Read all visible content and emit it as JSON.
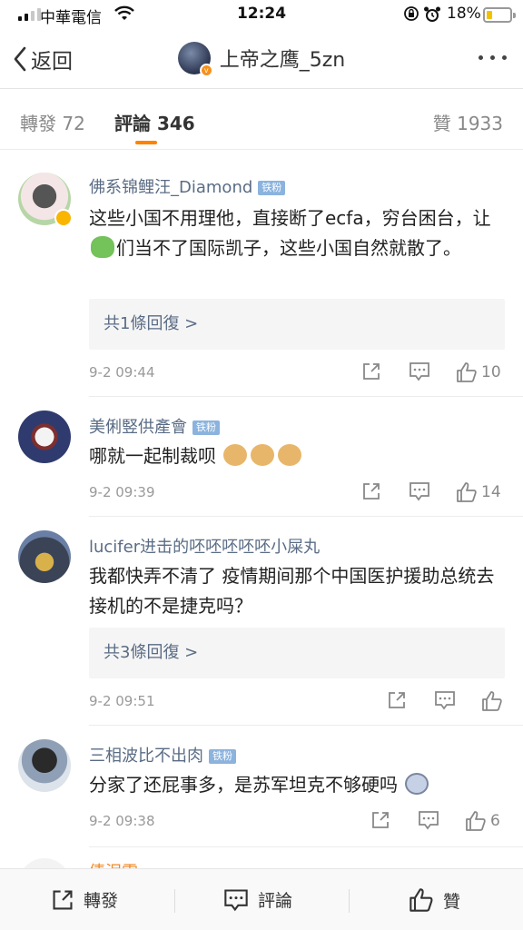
{
  "status": {
    "carrier": "中華電信",
    "time": "12:24",
    "battery": "18%"
  },
  "nav": {
    "back_label": "返回",
    "title": "上帝之鹰_5zn"
  },
  "tabs": {
    "repost": "轉發 72",
    "comment": "評論 346",
    "like": "贊 1933"
  },
  "comments": [
    {
      "name": "佛系锦鲤汪_Diamond",
      "badge": "铁粉",
      "text_a": "这些小国不用理他，直接断了ecfa，穷台困台，让",
      "text_b": "们当不了国际凯子，这些小国自然就散了。",
      "replies": "共1條回復 >",
      "time": "9-2 09:44",
      "likes": "10"
    },
    {
      "name": "美俐竪供產會",
      "badge": "铁粉",
      "text": "哪就一起制裁呗",
      "time": "9-2 09:39",
      "likes": "14"
    },
    {
      "name": "lucifer进击的呸呸呸呸呸小屎丸",
      "text": "我都快弄不清了 疫情期间那个中国医护援助总统去接机的不是捷克吗？",
      "replies": "共3條回復 >",
      "time": "9-2 09:51",
      "likes": ""
    },
    {
      "name": "三相波比不出肉",
      "badge": "铁粉",
      "text": "分家了还屁事多，是苏军坦克不够硬吗",
      "time": "9-2 09:38",
      "likes": "6"
    }
  ],
  "peek_name": "倩泥雪",
  "bottom": {
    "repost": "轉發",
    "comment": "評論",
    "like": "贊"
  },
  "colors": {
    "accent": "#ff8200",
    "name": "#5a6c85",
    "badge": "#8bb3de"
  },
  "icons": [
    "signal-icon",
    "wifi-icon",
    "rotation-lock-icon",
    "alarm-icon",
    "battery-icon",
    "back-chevron-icon",
    "more-icon",
    "share-icon",
    "comment-icon",
    "like-icon"
  ]
}
